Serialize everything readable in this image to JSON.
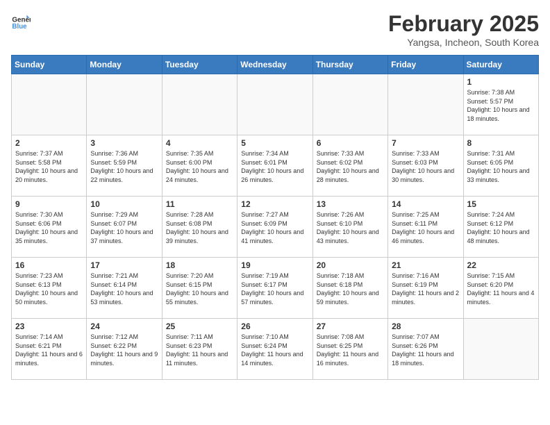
{
  "header": {
    "logo_line1": "General",
    "logo_line2": "Blue",
    "month_year": "February 2025",
    "location": "Yangsa, Incheon, South Korea"
  },
  "weekdays": [
    "Sunday",
    "Monday",
    "Tuesday",
    "Wednesday",
    "Thursday",
    "Friday",
    "Saturday"
  ],
  "weeks": [
    [
      {
        "day": "",
        "info": ""
      },
      {
        "day": "",
        "info": ""
      },
      {
        "day": "",
        "info": ""
      },
      {
        "day": "",
        "info": ""
      },
      {
        "day": "",
        "info": ""
      },
      {
        "day": "",
        "info": ""
      },
      {
        "day": "1",
        "info": "Sunrise: 7:38 AM\nSunset: 5:57 PM\nDaylight: 10 hours and 18 minutes."
      }
    ],
    [
      {
        "day": "2",
        "info": "Sunrise: 7:37 AM\nSunset: 5:58 PM\nDaylight: 10 hours and 20 minutes."
      },
      {
        "day": "3",
        "info": "Sunrise: 7:36 AM\nSunset: 5:59 PM\nDaylight: 10 hours and 22 minutes."
      },
      {
        "day": "4",
        "info": "Sunrise: 7:35 AM\nSunset: 6:00 PM\nDaylight: 10 hours and 24 minutes."
      },
      {
        "day": "5",
        "info": "Sunrise: 7:34 AM\nSunset: 6:01 PM\nDaylight: 10 hours and 26 minutes."
      },
      {
        "day": "6",
        "info": "Sunrise: 7:33 AM\nSunset: 6:02 PM\nDaylight: 10 hours and 28 minutes."
      },
      {
        "day": "7",
        "info": "Sunrise: 7:33 AM\nSunset: 6:03 PM\nDaylight: 10 hours and 30 minutes."
      },
      {
        "day": "8",
        "info": "Sunrise: 7:31 AM\nSunset: 6:05 PM\nDaylight: 10 hours and 33 minutes."
      }
    ],
    [
      {
        "day": "9",
        "info": "Sunrise: 7:30 AM\nSunset: 6:06 PM\nDaylight: 10 hours and 35 minutes."
      },
      {
        "day": "10",
        "info": "Sunrise: 7:29 AM\nSunset: 6:07 PM\nDaylight: 10 hours and 37 minutes."
      },
      {
        "day": "11",
        "info": "Sunrise: 7:28 AM\nSunset: 6:08 PM\nDaylight: 10 hours and 39 minutes."
      },
      {
        "day": "12",
        "info": "Sunrise: 7:27 AM\nSunset: 6:09 PM\nDaylight: 10 hours and 41 minutes."
      },
      {
        "day": "13",
        "info": "Sunrise: 7:26 AM\nSunset: 6:10 PM\nDaylight: 10 hours and 43 minutes."
      },
      {
        "day": "14",
        "info": "Sunrise: 7:25 AM\nSunset: 6:11 PM\nDaylight: 10 hours and 46 minutes."
      },
      {
        "day": "15",
        "info": "Sunrise: 7:24 AM\nSunset: 6:12 PM\nDaylight: 10 hours and 48 minutes."
      }
    ],
    [
      {
        "day": "16",
        "info": "Sunrise: 7:23 AM\nSunset: 6:13 PM\nDaylight: 10 hours and 50 minutes."
      },
      {
        "day": "17",
        "info": "Sunrise: 7:21 AM\nSunset: 6:14 PM\nDaylight: 10 hours and 53 minutes."
      },
      {
        "day": "18",
        "info": "Sunrise: 7:20 AM\nSunset: 6:15 PM\nDaylight: 10 hours and 55 minutes."
      },
      {
        "day": "19",
        "info": "Sunrise: 7:19 AM\nSunset: 6:17 PM\nDaylight: 10 hours and 57 minutes."
      },
      {
        "day": "20",
        "info": "Sunrise: 7:18 AM\nSunset: 6:18 PM\nDaylight: 10 hours and 59 minutes."
      },
      {
        "day": "21",
        "info": "Sunrise: 7:16 AM\nSunset: 6:19 PM\nDaylight: 11 hours and 2 minutes."
      },
      {
        "day": "22",
        "info": "Sunrise: 7:15 AM\nSunset: 6:20 PM\nDaylight: 11 hours and 4 minutes."
      }
    ],
    [
      {
        "day": "23",
        "info": "Sunrise: 7:14 AM\nSunset: 6:21 PM\nDaylight: 11 hours and 6 minutes."
      },
      {
        "day": "24",
        "info": "Sunrise: 7:12 AM\nSunset: 6:22 PM\nDaylight: 11 hours and 9 minutes."
      },
      {
        "day": "25",
        "info": "Sunrise: 7:11 AM\nSunset: 6:23 PM\nDaylight: 11 hours and 11 minutes."
      },
      {
        "day": "26",
        "info": "Sunrise: 7:10 AM\nSunset: 6:24 PM\nDaylight: 11 hours and 14 minutes."
      },
      {
        "day": "27",
        "info": "Sunrise: 7:08 AM\nSunset: 6:25 PM\nDaylight: 11 hours and 16 minutes."
      },
      {
        "day": "28",
        "info": "Sunrise: 7:07 AM\nSunset: 6:26 PM\nDaylight: 11 hours and 18 minutes."
      },
      {
        "day": "",
        "info": ""
      }
    ]
  ]
}
